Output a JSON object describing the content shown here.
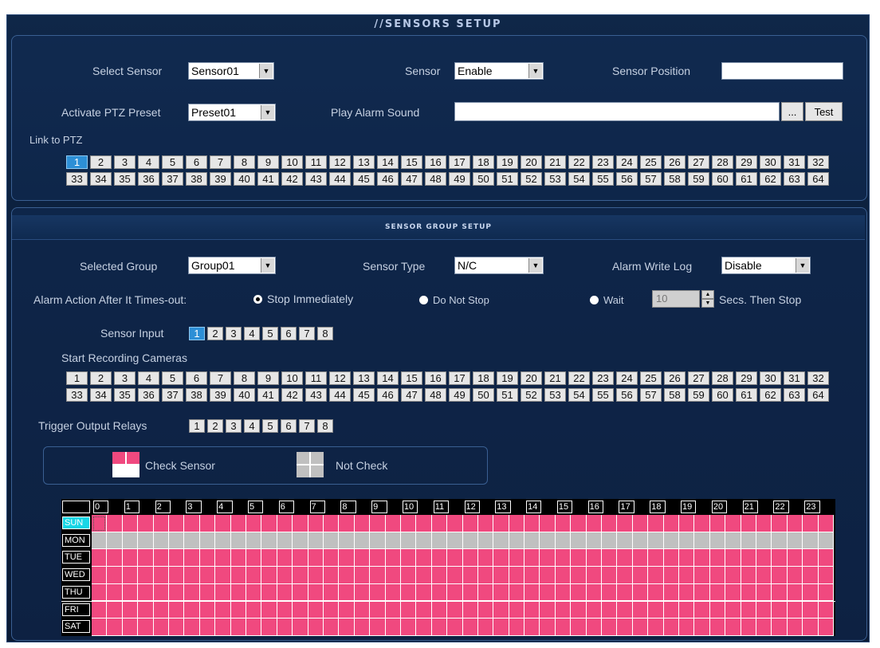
{
  "window": {
    "title": "//SENSORS SETUP"
  },
  "sensor_setup": {
    "select_sensor_label": "Select Sensor",
    "select_sensor_value": "Sensor01",
    "sensor_label": "Sensor",
    "sensor_value": "Enable",
    "sensor_position_label": "Sensor Position",
    "sensor_position_value": "",
    "activate_ptz_label": "Activate PTZ Preset",
    "activate_ptz_value": "Preset01",
    "play_alarm_label": "Play Alarm Sound",
    "play_alarm_value": "",
    "browse_button": "...",
    "test_button": "Test",
    "link_to_ptz_label": "Link to PTZ",
    "ptz_selected": 1
  },
  "group_setup": {
    "header": "SENSOR GROUP SETUP",
    "selected_group_label": "Selected Group",
    "selected_group_value": "Group01",
    "sensor_type_label": "Sensor Type",
    "sensor_type_value": "N/C",
    "alarm_write_log_label": "Alarm Write Log",
    "alarm_write_log_value": "Disable",
    "alarm_action_label": "Alarm Action After It Times-out:",
    "radio_stop": "Stop Immediately",
    "radio_do_not_stop": "Do Not Stop",
    "radio_wait": "Wait",
    "wait_value": "10",
    "wait_suffix": "Secs. Then Stop",
    "selected_action": "stop",
    "sensor_input_label": "Sensor Input",
    "sensor_input_selected": 1,
    "start_recording_label": "Start Recording Cameras",
    "trigger_output_label": "Trigger Output Relays"
  },
  "legend": {
    "check_label": "Check Sensor",
    "not_check_label": "Not Check"
  },
  "schedule": {
    "hours": [
      "0",
      "1",
      "2",
      "3",
      "4",
      "5",
      "6",
      "7",
      "8",
      "9",
      "10",
      "11",
      "12",
      "13",
      "14",
      "15",
      "16",
      "17",
      "18",
      "19",
      "20",
      "21",
      "22",
      "23"
    ],
    "days": [
      "SUN",
      "MON",
      "TUE",
      "WED",
      "THU",
      "FRI",
      "SAT"
    ],
    "active_day": "SUN",
    "day_states": [
      "check",
      "not_check",
      "check",
      "check",
      "check",
      "check",
      "check"
    ],
    "colors": {
      "check": "#f0497f",
      "not_check": "#c0c0c0",
      "active_day": "#18d6e6"
    }
  }
}
